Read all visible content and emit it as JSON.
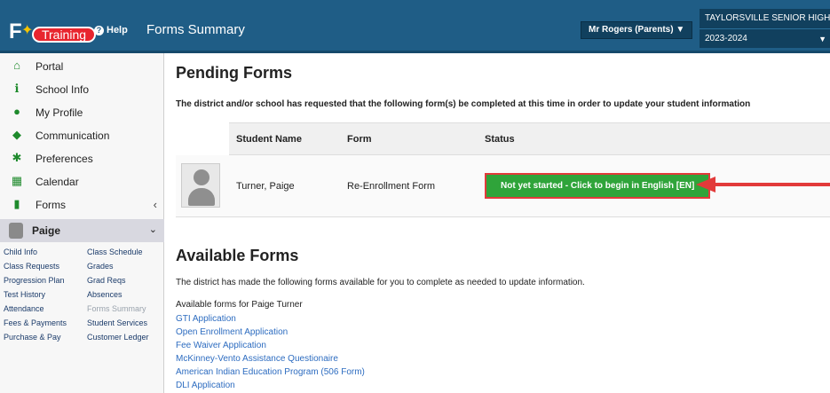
{
  "header": {
    "logo_letter": "F",
    "logo_badge": "Training",
    "help_label": "Help",
    "page_title": "Forms Summary",
    "user_label": "Mr Rogers (Parents)",
    "school": "TAYLORSVILLE SENIOR HIGH",
    "year": "2023-2024"
  },
  "sidebar": {
    "items": [
      {
        "label": "Portal",
        "icon": "home-icon"
      },
      {
        "label": "School Info",
        "icon": "info-icon"
      },
      {
        "label": "My Profile",
        "icon": "user-icon"
      },
      {
        "label": "Communication",
        "icon": "chat-icon"
      },
      {
        "label": "Preferences",
        "icon": "gear-icon"
      },
      {
        "label": "Calendar",
        "icon": "calendar-icon"
      },
      {
        "label": "Forms",
        "icon": "file-icon"
      }
    ],
    "student": "Paige",
    "links": [
      [
        "Child Info",
        "Class Schedule"
      ],
      [
        "Class Requests",
        "Grades"
      ],
      [
        "Progression Plan",
        "Grad Reqs"
      ],
      [
        "Test History",
        "Absences"
      ],
      [
        "Attendance",
        "Forms Summary"
      ],
      [
        "Fees & Payments",
        "Student Services"
      ],
      [
        "Purchase & Pay",
        "Customer Ledger"
      ]
    ]
  },
  "pending": {
    "title": "Pending Forms",
    "intro": "The district and/or school has requested that the following form(s) be completed at this time in order to update your student information",
    "columns": [
      "Student Name",
      "Form",
      "Status"
    ],
    "row": {
      "student": "Turner, Paige",
      "form": "Re-Enrollment Form",
      "status": "Not yet started - Click to begin in English [EN]"
    }
  },
  "available": {
    "title": "Available Forms",
    "intro": "The district has made the following forms available for you to complete as needed to update information.",
    "for_label": "Available forms for Paige Turner",
    "forms": [
      "GTI Application",
      "Open Enrollment Application",
      "Fee Waiver Application",
      "McKinney-Vento Assistance Questionaire",
      "American Indian Education Program (506 Form)",
      "DLI Application"
    ]
  },
  "colors": {
    "topbar": "#1f5d86",
    "accent_green": "#2fa43a",
    "arrow_red": "#e23a3a",
    "link": "#2d6cc0"
  }
}
